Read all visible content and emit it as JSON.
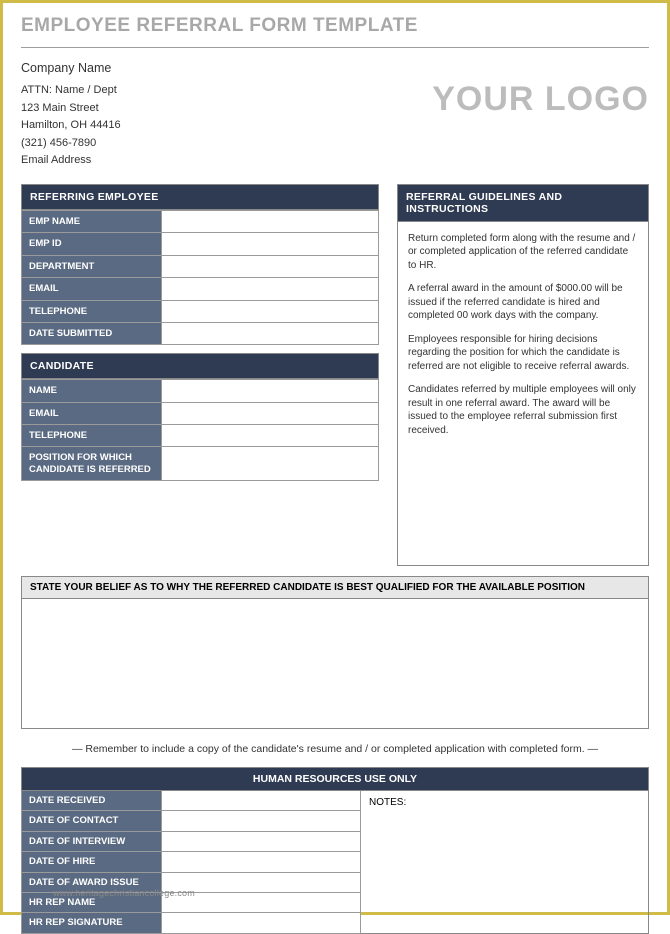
{
  "title": "EMPLOYEE REFERRAL FORM TEMPLATE",
  "company": {
    "name": "Company Name",
    "attn": "ATTN: Name / Dept",
    "street": "123 Main Street",
    "city": "Hamilton, OH  44416",
    "phone": "(321) 456-7890",
    "email": "Email Address"
  },
  "logo_text": "YOUR LOGO",
  "referring": {
    "header": "REFERRING EMPLOYEE",
    "fields": [
      {
        "label": "EMP NAME",
        "value": ""
      },
      {
        "label": "EMP ID",
        "value": ""
      },
      {
        "label": "DEPARTMENT",
        "value": ""
      },
      {
        "label": "EMAIL",
        "value": ""
      },
      {
        "label": "TELEPHONE",
        "value": ""
      },
      {
        "label": "DATE SUBMITTED",
        "value": ""
      }
    ]
  },
  "candidate": {
    "header": "CANDIDATE",
    "fields": [
      {
        "label": "NAME",
        "value": ""
      },
      {
        "label": "EMAIL",
        "value": ""
      },
      {
        "label": "TELEPHONE",
        "value": ""
      },
      {
        "label": "POSITION FOR WHICH CANDIDATE IS REFERRED",
        "value": ""
      }
    ]
  },
  "guidelines": {
    "header": "REFERRAL GUIDELINES AND INSTRUCTIONS",
    "paragraphs": [
      "Return completed form along with the resume and / or completed application of the referred candidate to HR.",
      "A referral award in the amount of $000.00 will be issued if the referred candidate is hired and completed 00 work days with the company.",
      "Employees responsible for hiring decisions regarding the position for which the candidate is referred are not eligible to receive referral awards.",
      "Candidates referred by multiple employees will only result in one referral award.  The award will be issued to the employee referral submission first received."
    ]
  },
  "belief": {
    "header": "STATE YOUR BELIEF AS TO WHY THE REFERRED CANDIDATE IS BEST QUALIFIED FOR THE AVAILABLE POSITION",
    "value": ""
  },
  "reminder": "— Remember to include a copy of the candidate's resume and / or completed application with completed form. —",
  "hr": {
    "header": "HUMAN RESOURCES USE ONLY",
    "notes_label": "NOTES:",
    "notes": "",
    "fields": [
      {
        "label": "DATE RECEIVED",
        "value": ""
      },
      {
        "label": "DATE OF CONTACT",
        "value": ""
      },
      {
        "label": "DATE OF INTERVIEW",
        "value": ""
      },
      {
        "label": "DATE OF HIRE",
        "value": ""
      },
      {
        "label": "DATE OF AWARD ISSUE",
        "value": ""
      },
      {
        "label": "HR REP NAME",
        "value": ""
      },
      {
        "label": "HR REP SIGNATURE",
        "value": ""
      }
    ]
  },
  "watermark": "www.heritagechristiancollege.com"
}
